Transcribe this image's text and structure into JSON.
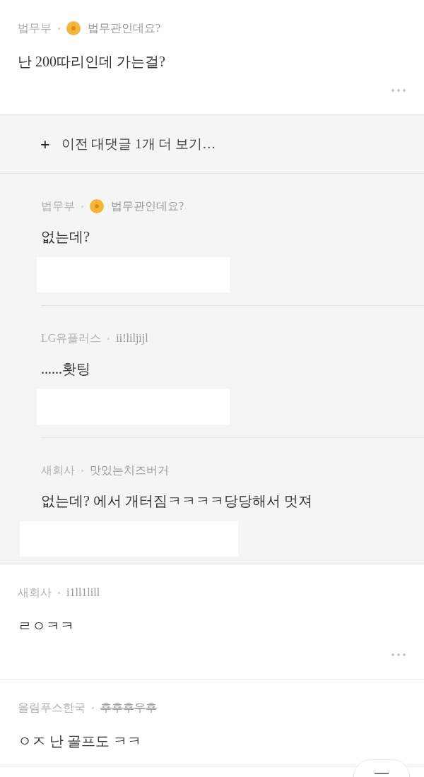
{
  "comments": [
    {
      "kind": "comment",
      "company": "법무부",
      "badge": true,
      "nickname": "법무관인데요?",
      "struck": false,
      "text": "난 200따리인데 가는걸?",
      "more": true
    },
    {
      "kind": "more_replies",
      "label": "이전 대댓글 1개 더 보기…",
      "icon": "+"
    },
    {
      "kind": "reply",
      "company": "법무부",
      "badge": true,
      "nickname": "법무관인데요?",
      "struck": false,
      "text": "없는데?",
      "redacted": true,
      "divider": true,
      "wide_redaction": false
    },
    {
      "kind": "reply",
      "company": "LG유플러스",
      "badge": false,
      "nickname": "ii!liljijl",
      "struck": false,
      "text": "......홧팅",
      "redacted": true,
      "divider": true,
      "wide_redaction": false
    },
    {
      "kind": "reply",
      "company": "새회사",
      "badge": false,
      "nickname": "맛있는치즈버거",
      "struck": false,
      "text": "없는데? 에서 개터짐ㅋㅋㅋㅋ당당해서 멋져",
      "redacted": true,
      "divider": false,
      "wide_redaction": true
    },
    {
      "kind": "comment",
      "company": "새회사",
      "badge": false,
      "nickname": "i1ll1lill",
      "struck": false,
      "text": "ㄹㅇㅋㅋ",
      "more": true
    },
    {
      "kind": "comment",
      "company": "올림푸스한국",
      "badge": false,
      "nickname": "후후후우후",
      "struck": true,
      "text": "ㅇㅈ 난 골프도 ㅋㅋ",
      "more": false
    }
  ],
  "floating_button": true
}
